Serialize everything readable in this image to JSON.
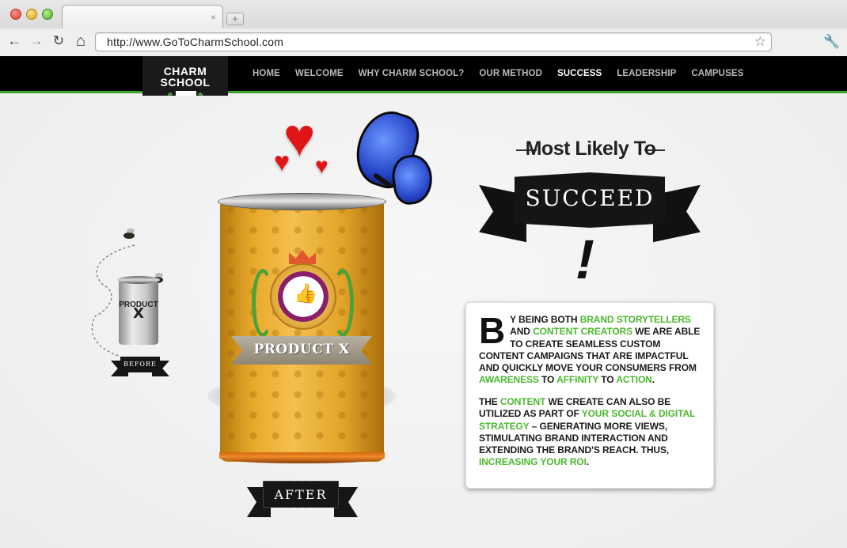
{
  "browser": {
    "url": "http://www.GoToCharmSchool.com",
    "tab_close_glyph": "×",
    "new_tab_glyph": "+",
    "back_glyph": "←",
    "forward_glyph": "→",
    "reload_glyph": "↻",
    "home_glyph": "⌂",
    "star_glyph": "☆",
    "wrench_glyph": "🔧"
  },
  "logo": {
    "line1": "CHARM",
    "line2": "SCHOOL"
  },
  "nav": {
    "items": [
      {
        "label": "HOME"
      },
      {
        "label": "WELCOME"
      },
      {
        "label": "WHY CHARM SCHOOL?"
      },
      {
        "label": "OUR METHOD"
      },
      {
        "label": "SUCCESS"
      },
      {
        "label": "LEADERSHIP"
      },
      {
        "label": "CAMPUSES"
      }
    ],
    "active": "SUCCESS"
  },
  "hero": {
    "small_can_line1": "PRODUCT",
    "small_can_line2": "X",
    "before_label": "BEFORE",
    "big_can_label": "PRODUCT X",
    "after_label": "AFTER",
    "heart_glyph": "♥",
    "thumb_glyph": "👍"
  },
  "headline": {
    "kicker": "Most Likely To",
    "banner": "SUCCEED",
    "exclaim": "!"
  },
  "card": {
    "drop_cap": "B",
    "p1": [
      {
        "t": "Y BEING BOTH ",
        "hl": false
      },
      {
        "t": "BRAND STORYTELLERS",
        "hl": true
      },
      {
        "t": " AND ",
        "hl": false
      },
      {
        "t": "CONTENT CREATORS",
        "hl": true
      },
      {
        "t": " WE ARE ABLE TO CREATE SEAMLESS CUSTOM CONTENT CAMPAIGNS THAT ARE IMPACTFUL AND QUICKLY MOVE YOUR CONSUMERS FROM ",
        "hl": false
      },
      {
        "t": "AWARENESS",
        "hl": true
      },
      {
        "t": " TO ",
        "hl": false
      },
      {
        "t": "AFFINITY",
        "hl": true
      },
      {
        "t": " TO ",
        "hl": false
      },
      {
        "t": "ACTION",
        "hl": true
      },
      {
        "t": ".",
        "hl": false
      }
    ],
    "p2": [
      {
        "t": "THE ",
        "hl": false
      },
      {
        "t": "CONTENT",
        "hl": true
      },
      {
        "t": " WE CREATE CAN ALSO BE UTILIZED AS PART OF ",
        "hl": false
      },
      {
        "t": "YOUR SOCIAL & DIGITAL STRATEGY",
        "hl": true
      },
      {
        "t": " – GENERATING MORE VIEWS, STIMULATING BRAND INTERACTION AND EXTENDING THE BRAND'S REACH. THUS, ",
        "hl": false
      },
      {
        "t": "INCREASING YOUR ROI",
        "hl": true
      },
      {
        "t": ".",
        "hl": false
      }
    ]
  },
  "colors": {
    "accent_green": "#4bb82e",
    "nav_bg": "#000000",
    "can_gold": "#e8a92a"
  }
}
